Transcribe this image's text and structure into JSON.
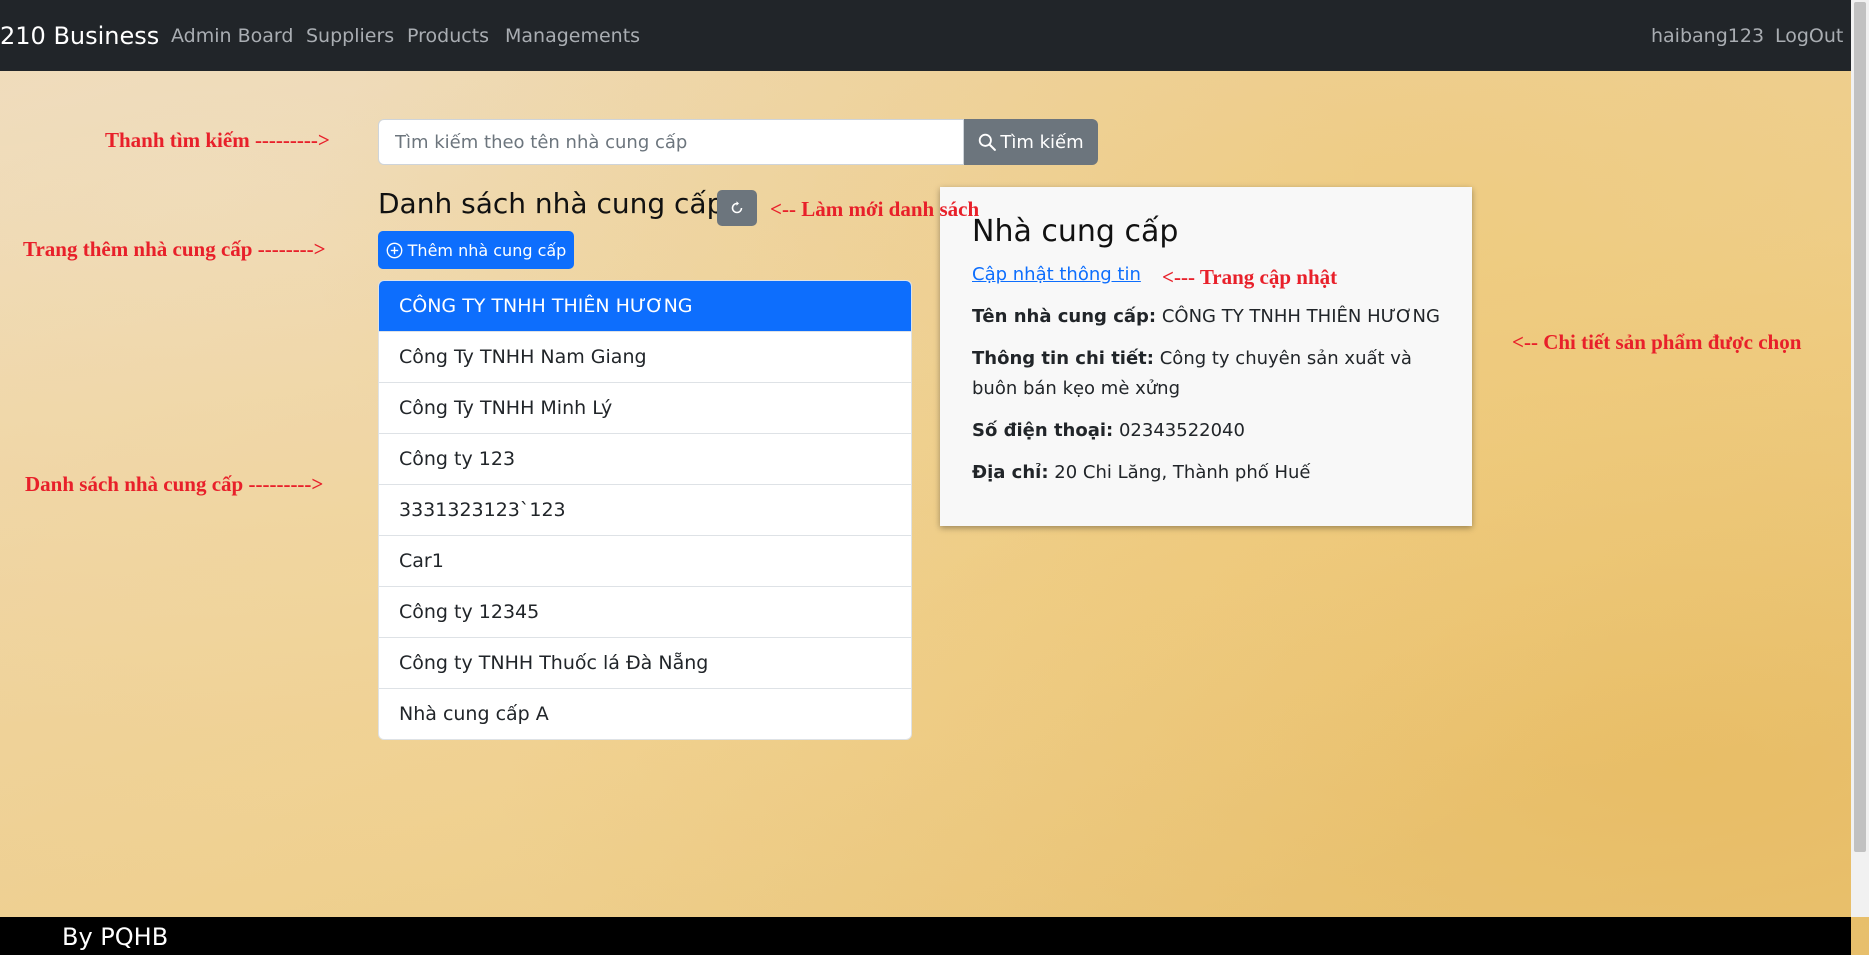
{
  "nav": {
    "brand": "210 Business",
    "links": [
      "Admin Board",
      "Suppliers",
      "Products",
      "Managements"
    ],
    "user": "haibang123",
    "logout": "LogOut"
  },
  "search": {
    "placeholder": "Tìm kiếm theo tên nhà cung cấp",
    "button": "Tìm kiếm"
  },
  "list_title": "Danh sách nhà cung cấp",
  "add_button": "Thêm nhà cung cấp",
  "suppliers": [
    "CÔNG TY TNHH THIÊN HƯƠNG",
    "Công Ty TNHH Nam Giang",
    "Công Ty TNHH Minh Lý",
    "Công ty 123",
    "3331323123`123",
    "Car1",
    "Công ty 12345",
    "Công ty TNHH Thuốc lá Đà Nẵng",
    "Nhà cung cấp A"
  ],
  "detail": {
    "title": "Nhà cung cấp",
    "update_link": "Cập nhật thông tin",
    "name_label": "Tên nhà cung cấp:",
    "name_value": "CÔNG TY TNHH THIÊN HƯƠNG",
    "info_label": "Thông tin chi tiết:",
    "info_value": "Công ty chuyên sản xuất và buôn bán kẹo mè xửng",
    "phone_label": "Số điện thoại:",
    "phone_value": "02343522040",
    "address_label": "Địa chỉ:",
    "address_value": "20 Chi Lăng, Thành phố Huế"
  },
  "annotations": {
    "search_bar": "Thanh tìm kiếm --------->",
    "refresh": "<-- Làm mới danh sách",
    "add_page": "Trang thêm nhà cung cấp -------->",
    "update_page": "<--- Trang cập nhật",
    "detail": "<-- Chi tiết sản phẩm được chọn",
    "list": "Danh sách nhà cung cấp --------->"
  },
  "footer": "By PQHB"
}
